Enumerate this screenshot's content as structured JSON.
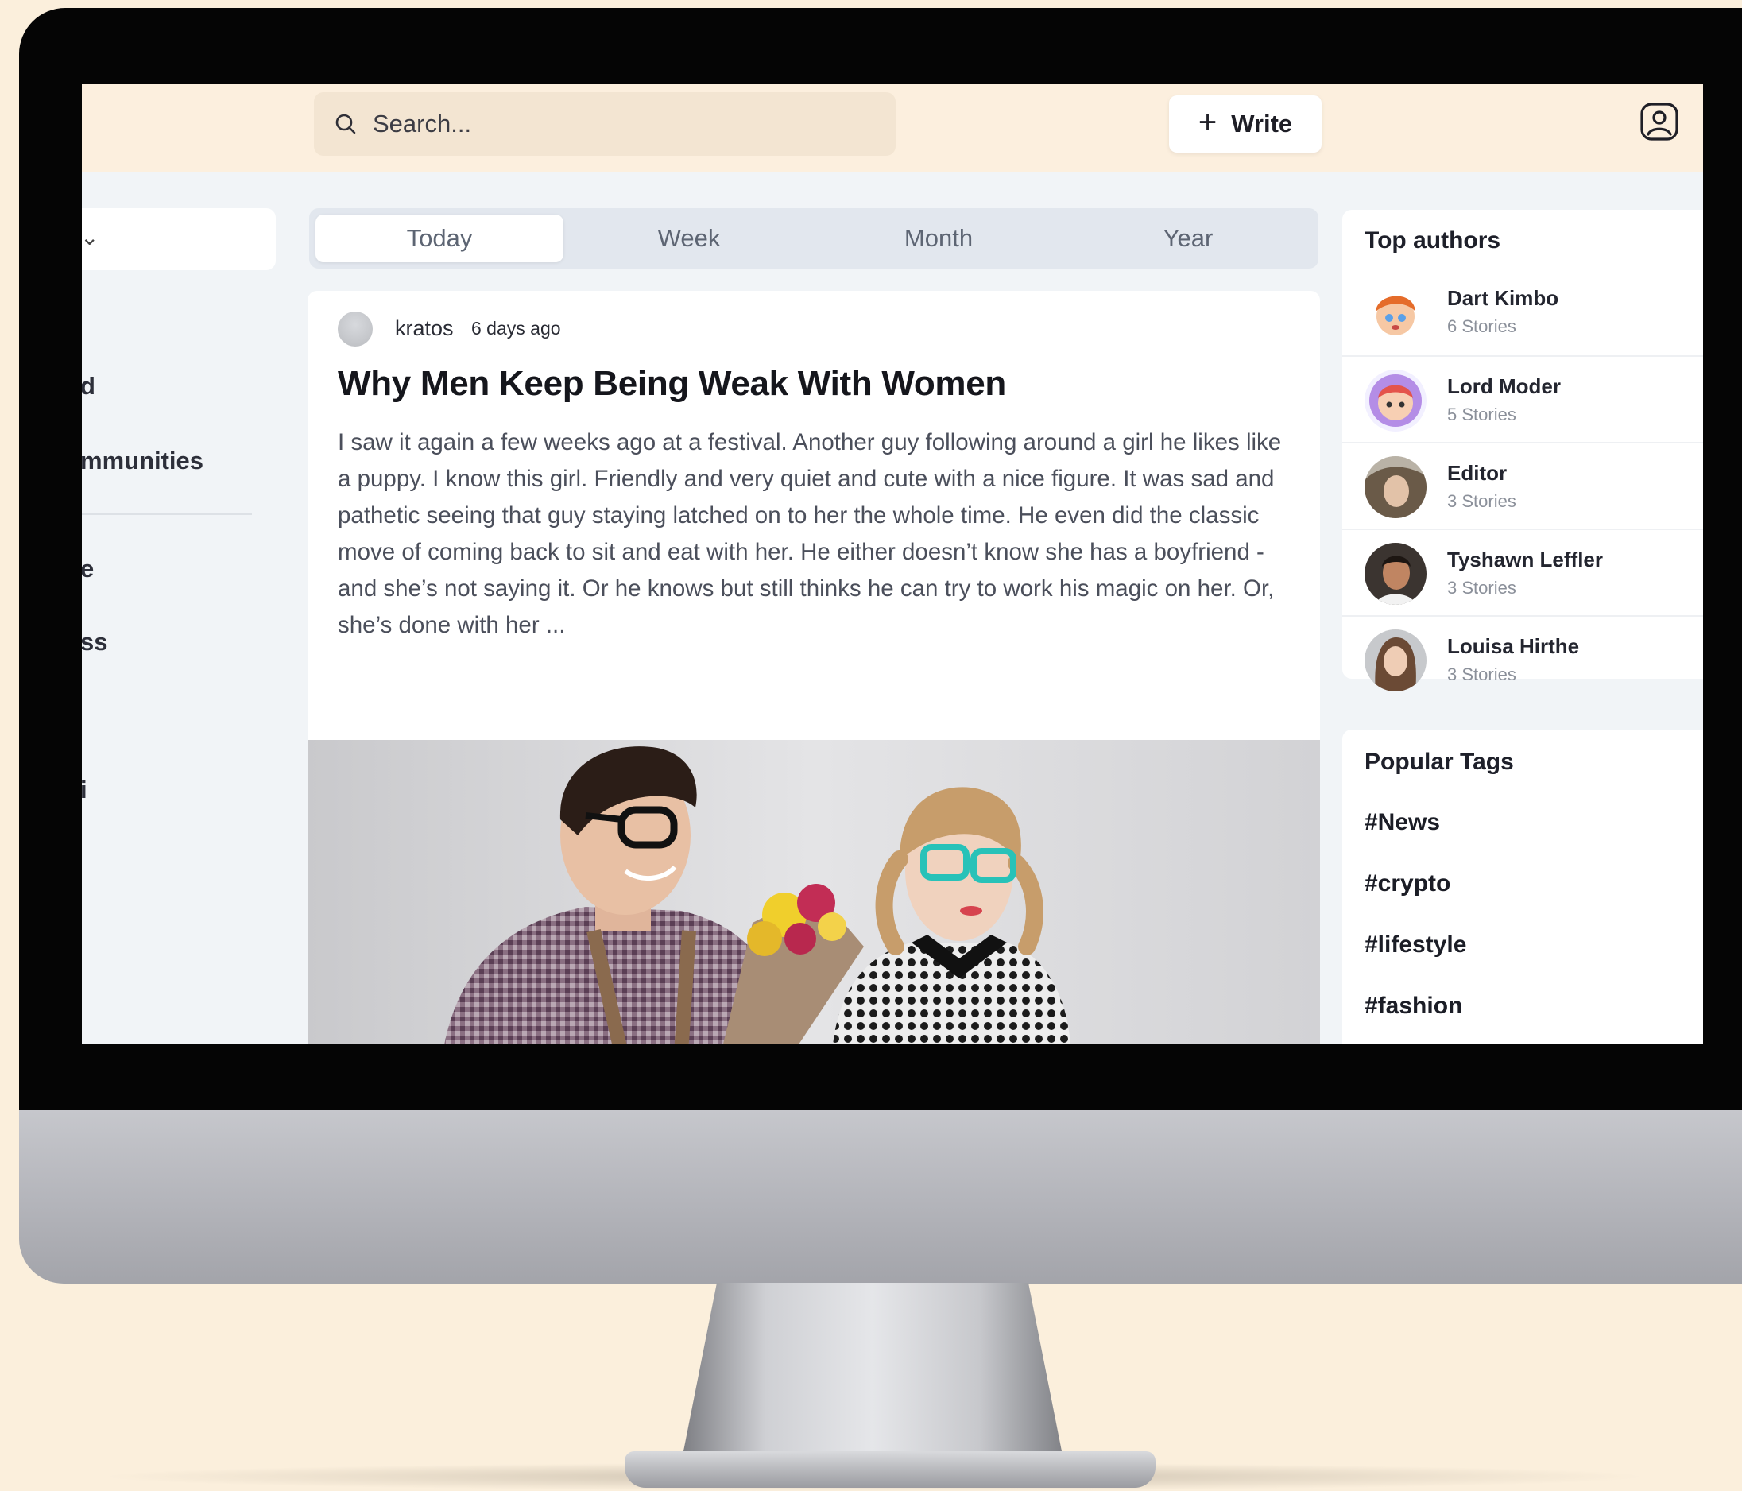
{
  "search": {
    "placeholder": "Search..."
  },
  "toolbar": {
    "write_label": "Write"
  },
  "sidebar": {
    "items": [
      {
        "label": "d"
      },
      {
        "label": "mmunities"
      },
      {
        "label": "e"
      },
      {
        "label": "ss"
      },
      {
        "label": "i"
      }
    ]
  },
  "tabs": [
    {
      "label": "Today",
      "active": true
    },
    {
      "label": "Week",
      "active": false
    },
    {
      "label": "Month",
      "active": false
    },
    {
      "label": "Year",
      "active": false
    }
  ],
  "post": {
    "author": "kratos",
    "time": "6 days ago",
    "title": "Why Men Keep Being Weak With Women",
    "body": "I saw it again a few weeks ago at a festival. Another guy following around a girl he likes like a puppy. I know this girl. Friendly and very quiet and cute with a nice figure. It was sad and pathetic seeing that guy staying latched on to her the whole time. He even did the classic move of coming back to sit and eat with her. He either doesn’t know she has a boyfriend - and she’s not saying it. Or he knows but still thinks he can try to work his magic on her. Or, she’s done with her ..."
  },
  "top_authors": {
    "title": "Top authors",
    "authors": [
      {
        "name": "Dart Kimbo",
        "stories": "6 Stories"
      },
      {
        "name": "Lord Moder",
        "stories": "5 Stories"
      },
      {
        "name": "Editor",
        "stories": "3 Stories"
      },
      {
        "name": "Tyshawn Leffler",
        "stories": "3 Stories"
      },
      {
        "name": "Louisa Hirthe",
        "stories": "3 Stories"
      }
    ]
  },
  "popular_tags": {
    "title": "Popular Tags",
    "tags": [
      "#News",
      "#crypto",
      "#lifestyle",
      "#fashion"
    ]
  },
  "colors": {
    "background": "#fbefdc",
    "topbar": "#fcefde",
    "screen_bg": "#f1f4f7",
    "bezel": "#050505"
  }
}
